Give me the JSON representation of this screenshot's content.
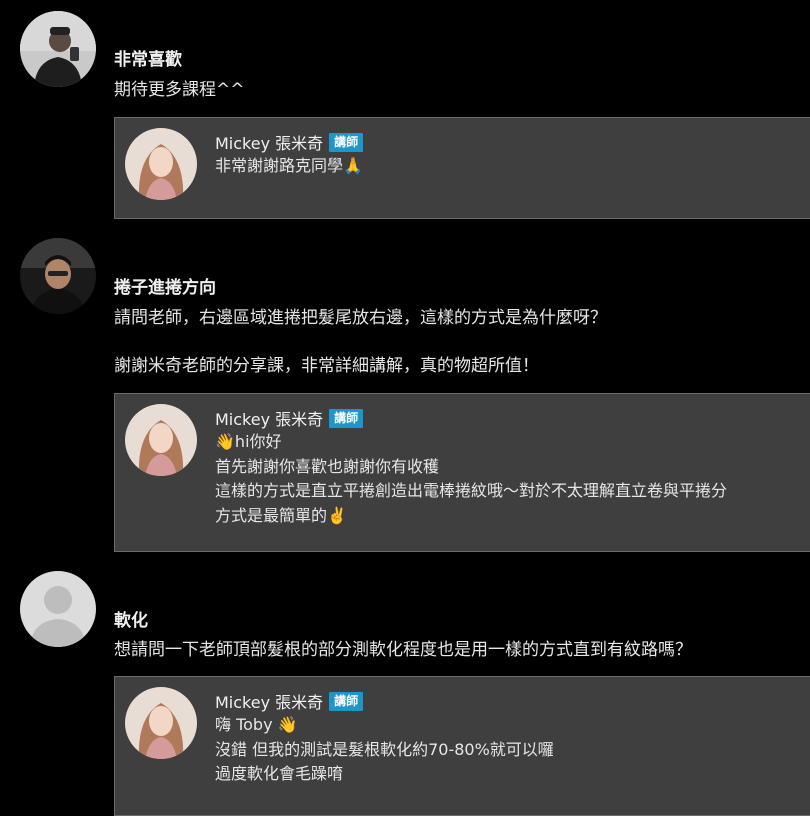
{
  "colors": {
    "background": "#000000",
    "reply_background": "#3f3f3f",
    "badge": "#1d97c9"
  },
  "comments": [
    {
      "username": "非常喜歡",
      "lines": [
        "期待更多課程^^"
      ],
      "avatar_icon": "user-photo-avatar",
      "reply": {
        "name": "Mickey 張米奇",
        "badge": "講師",
        "lines": [
          "非常謝謝路克同學🙏"
        ]
      }
    },
    {
      "username": "捲子進捲方向",
      "lines": [
        "請問老師，右邊區域進捲把髮尾放右邊，這樣的方式是為什麼呀？",
        "",
        "謝謝米奇老師的分享課，非常詳細講解，真的物超所值！"
      ],
      "avatar_icon": "user-photo-avatar",
      "reply": {
        "name": "Mickey 張米奇",
        "badge": "講師",
        "lines": [
          "👋hi你好",
          "首先謝謝你喜歡也謝謝你有收穫",
          "這樣的方式是直立平捲創造出電棒捲紋哦～對於不太理解直立卷與平捲分",
          "方式是最簡單的✌️"
        ]
      }
    },
    {
      "username": "軟化",
      "lines": [
        "想請問一下老師頂部髮根的部分測軟化程度也是用一樣的方式直到有紋路嗎？"
      ],
      "avatar_icon": "default-user-avatar",
      "reply": {
        "name": "Mickey 張米奇",
        "badge": "講師",
        "lines": [
          "嗨 Toby 👋",
          "沒錯 但我的測試是髮根軟化約70-80%就可以囉",
          "過度軟化會毛躁唷"
        ]
      }
    }
  ]
}
